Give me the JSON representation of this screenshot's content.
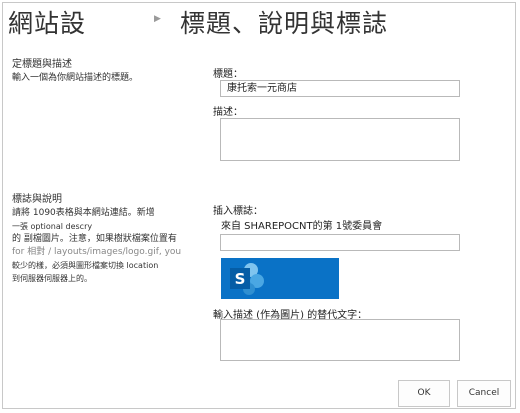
{
  "header": {
    "site_title": "網站設",
    "page_title": "標題、說明與標誌"
  },
  "section1": {
    "heading": "定標題與描述",
    "description": "輸入一個為你網站描述的標題。",
    "title_label": "標題：",
    "title_value": "康托索一元商店",
    "description_label": "描述："
  },
  "section2": {
    "heading": "標誌與說明",
    "desc_lines": [
      "請將 1090表格與本網站連結。新增",
      "一張 optional descry",
      "的 副檔圖片。注意，如果樹狀檔案位置有",
      "for 相對     / layouts/images/logo.gif, you",
      "較少的樣，必須與圖形檔案切換      location",
      "到伺服器伺服器上的。"
    ],
    "insert_logo_label": "插入標誌：",
    "logo_source_text": "來自 SHAREPOCNT的第 1號委員會",
    "logo_url_value": "",
    "alt_text_label": "輸入描述 (作為圖片) 的替代文字："
  },
  "buttons": {
    "ok": "OK",
    "cancel": "Cancel"
  },
  "icons": {
    "breadcrumb": "breadcrumb-arrow-icon",
    "logo": "sharepoint-logo-icon"
  },
  "colors": {
    "logo_background": "#0a72c6"
  }
}
